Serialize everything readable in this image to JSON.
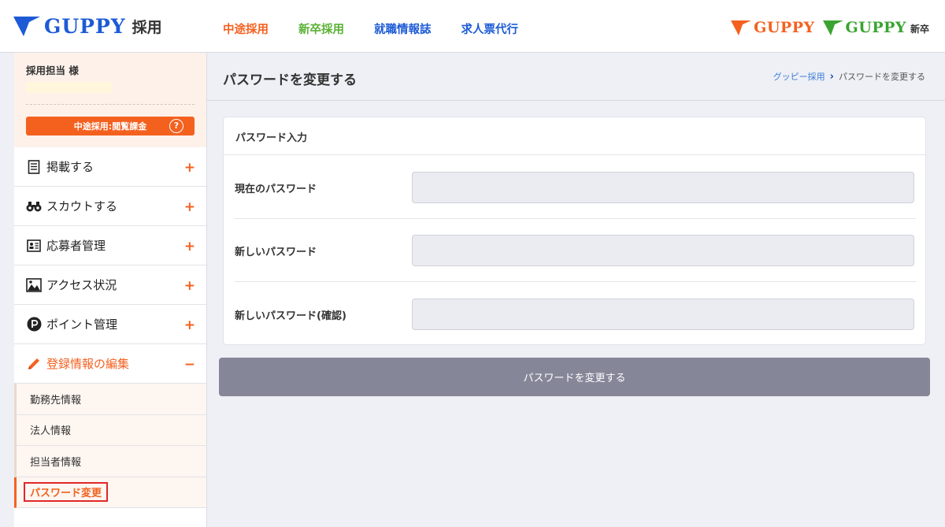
{
  "header": {
    "logo_text": "GUPPY",
    "logo_sub": "採用",
    "nav": [
      {
        "label": "中途採用",
        "color": "#f4611f"
      },
      {
        "label": "新卒採用",
        "color": "#5bb135"
      },
      {
        "label": "就職情報誌",
        "color": "#1d5bd6"
      },
      {
        "label": "求人票代行",
        "color": "#1d5bd6"
      }
    ],
    "brand_mid_text": "GUPPY",
    "brand_new_text": "GUPPY",
    "brand_new_sub": "新卒"
  },
  "sidebar": {
    "user_name": "採用担当 様",
    "plan_label": "中途採用:閲覧課金",
    "plan_help": "?",
    "menu": [
      {
        "label": "掲載する",
        "icon": "document-icon",
        "toggle": "+"
      },
      {
        "label": "スカウトする",
        "icon": "binoculars-icon",
        "toggle": "+"
      },
      {
        "label": "応募者管理",
        "icon": "applicant-card-icon",
        "toggle": "+"
      },
      {
        "label": "アクセス状況",
        "icon": "image-chart-icon",
        "toggle": "+"
      },
      {
        "label": "ポイント管理",
        "icon": "point-p-icon",
        "toggle": "+"
      },
      {
        "label": "登録情報の編集",
        "icon": "pencil-icon",
        "toggle": "−"
      }
    ],
    "submenu": [
      {
        "label": "勤務先情報"
      },
      {
        "label": "法人情報"
      },
      {
        "label": "担当者情報"
      },
      {
        "label": "パスワード変更"
      }
    ]
  },
  "page": {
    "title": "パスワードを変更する",
    "breadcrumb_home": "グッピー採用",
    "breadcrumb_current": "パスワードを変更する"
  },
  "form": {
    "section_title": "パスワード入力",
    "current_label": "現在のパスワード",
    "new_label": "新しいパスワード",
    "confirm_label": "新しいパスワード(確認)",
    "current_value": "",
    "new_value": "",
    "confirm_value": "",
    "submit_label": "パスワードを変更する"
  },
  "colors": {
    "accent_orange": "#f4611f",
    "accent_green": "#5bb135",
    "brand_blue": "#1d5bd6",
    "submit_gray": "#858698"
  }
}
